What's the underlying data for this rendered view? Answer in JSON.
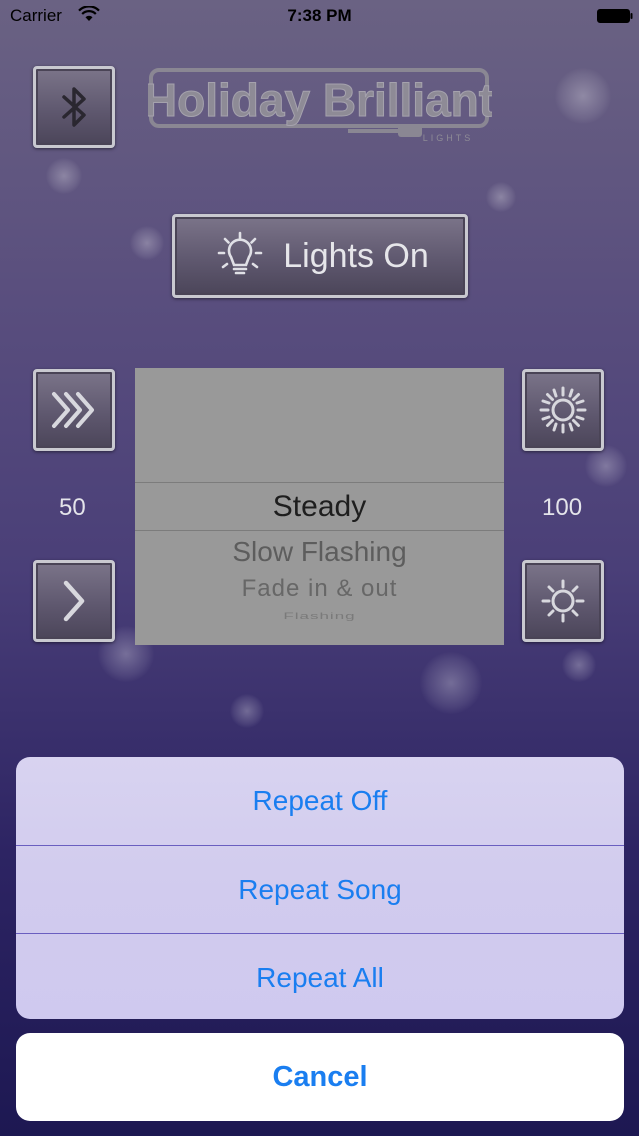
{
  "status_bar": {
    "carrier": "Carrier",
    "time": "7:38 PM"
  },
  "header": {
    "logo_text": "Holiday Brilliant",
    "logo_sub": "LIGHTS"
  },
  "lights_button": {
    "label": "Lights On"
  },
  "speed": {
    "value": "50"
  },
  "brightness": {
    "value": "100"
  },
  "picker": {
    "options": [
      "Steady",
      "Slow Flashing",
      "Fade in & out",
      "Flashing"
    ],
    "selected": "Steady"
  },
  "action_sheet": {
    "items": [
      "Repeat Off",
      "Repeat Song",
      "Repeat All"
    ],
    "cancel": "Cancel"
  },
  "colors": {
    "accent": "#1a7ef0",
    "picker_bg": "#999999"
  }
}
